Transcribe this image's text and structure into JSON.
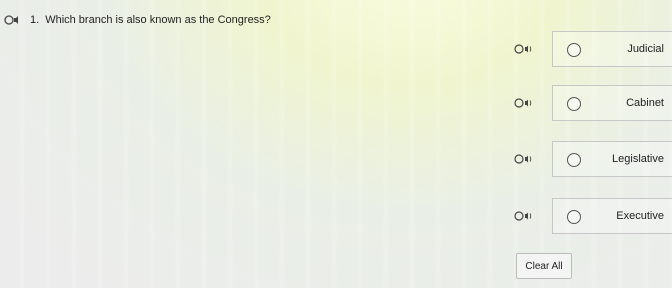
{
  "question": {
    "number": "1.",
    "text": "Which branch is also known as the Congress?"
  },
  "choices": [
    {
      "label": "Judicial"
    },
    {
      "label": "Cabinet"
    },
    {
      "label": "Legislative"
    },
    {
      "label": "Executive"
    }
  ],
  "clear_all_label": "Clear All",
  "icons": {
    "audio": "speaker-icon",
    "radio": "radio-button"
  }
}
